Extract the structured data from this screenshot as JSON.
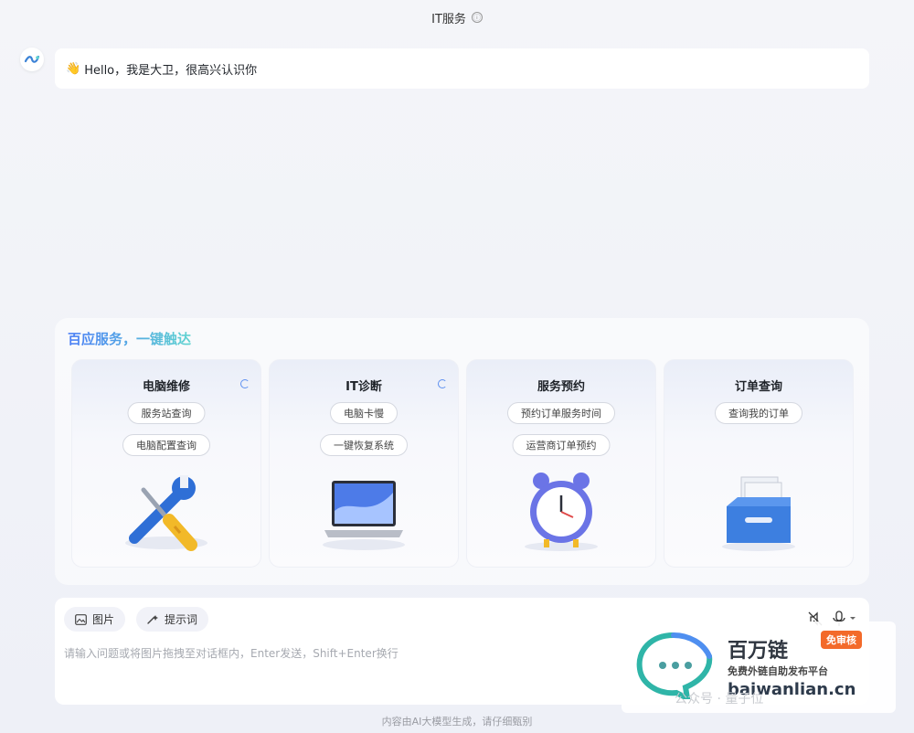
{
  "header": {
    "title": "IT服务",
    "info_icon": "ⓘ"
  },
  "chat": {
    "greeting": "Hello，我是大卫，很高兴认识你",
    "greeting_emoji": "👋"
  },
  "services": {
    "title": "百应服务，一键触达",
    "cards": [
      {
        "title": "电脑维修",
        "chips": [
          "服务站查询",
          "电脑配置查询"
        ],
        "icon": "tools-icon",
        "refreshable": true
      },
      {
        "title": "IT诊断",
        "chips": [
          "电脑卡慢",
          "一键恢复系统"
        ],
        "icon": "laptop-icon",
        "refreshable": true
      },
      {
        "title": "服务预约",
        "chips": [
          "预约订单服务时间",
          "运营商订单预约"
        ],
        "icon": "alarm-clock-icon",
        "refreshable": false
      },
      {
        "title": "订单查询",
        "chips": [
          "查询我的订单"
        ],
        "icon": "file-box-icon",
        "refreshable": false
      }
    ]
  },
  "composer": {
    "image_button": "图片",
    "prompt_button": "提示词",
    "placeholder": "请输入问题或将图片拖拽至对话框内，Enter发送，Shift+Enter换行"
  },
  "footer": {
    "disclaimer": "内容由AI大模型生成，请仔细甄别"
  },
  "watermark": {
    "title": "百万链",
    "badge": "免审核",
    "subtitle": "免费外链自助发布平台",
    "url": "baiwanlian.cn",
    "footer_text": "公众号 · 量子位"
  },
  "colors": {
    "accent": "#4a7ef6",
    "accent2": "#5fd3d0"
  }
}
